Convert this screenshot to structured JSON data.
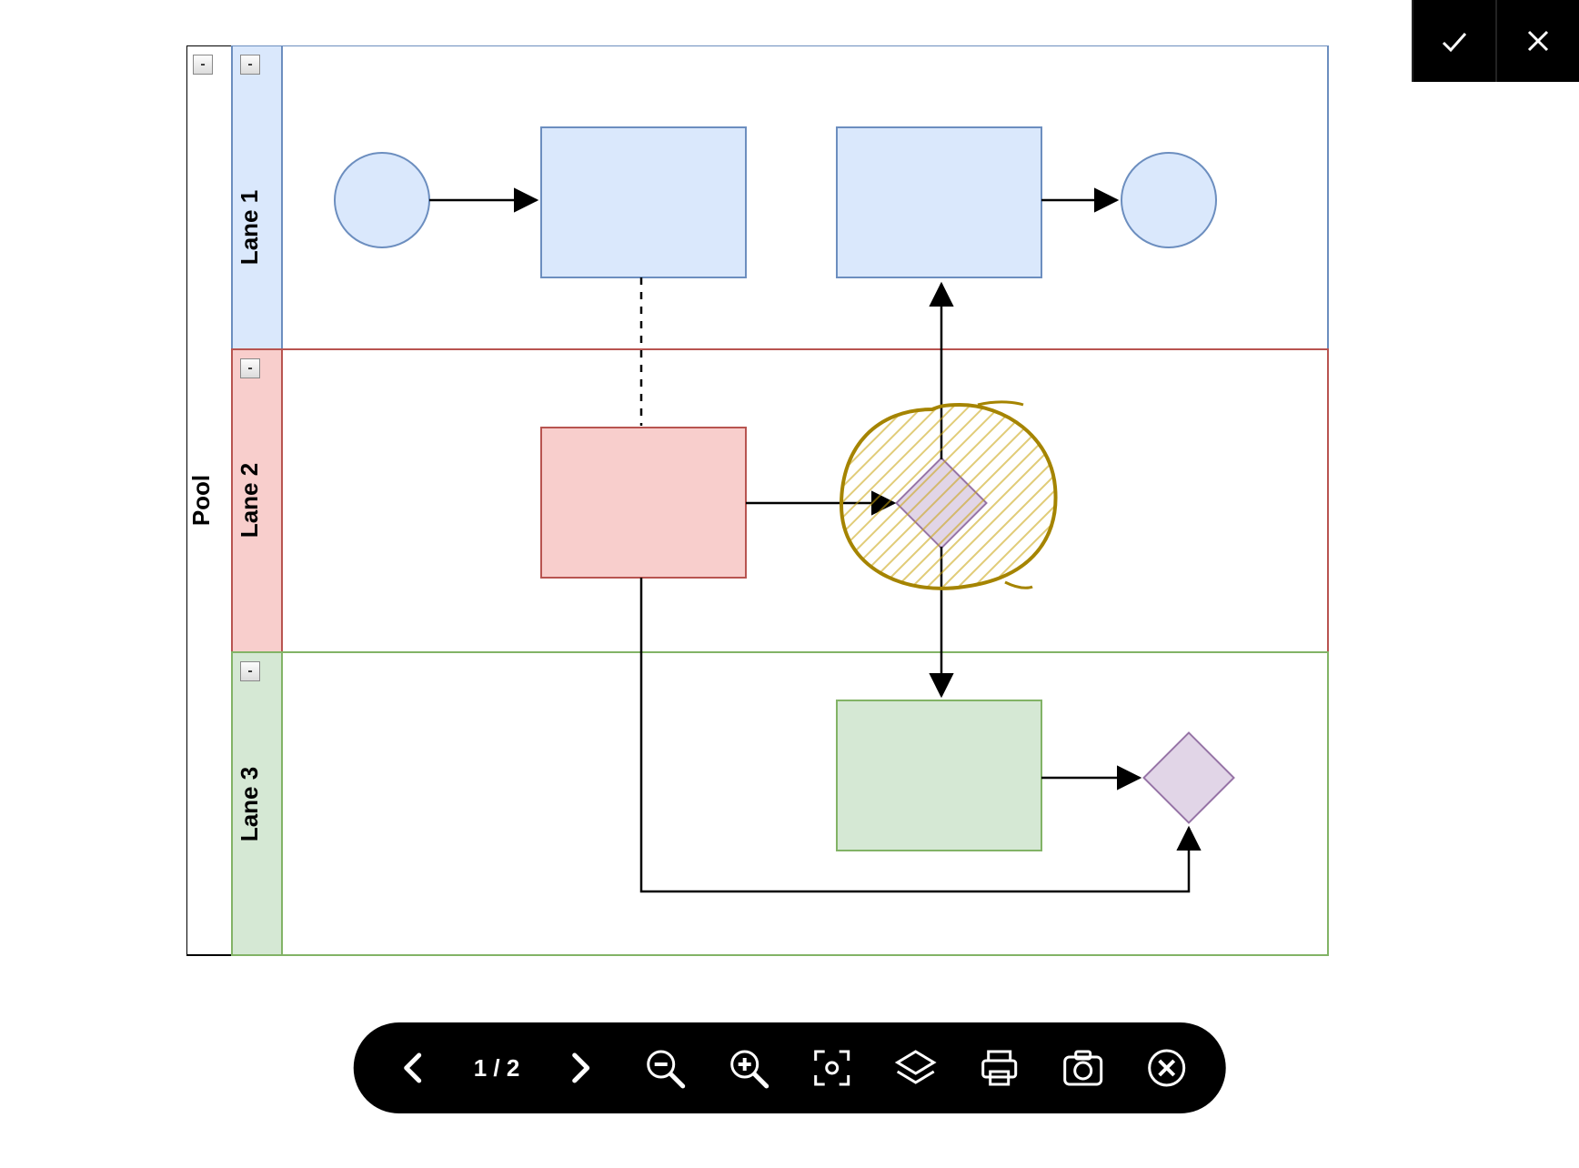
{
  "pool": {
    "title": "Pool",
    "lanes": [
      {
        "label": "Lane 1",
        "fill": "#dae8fc",
        "stroke": "#6c8ebf"
      },
      {
        "label": "Lane 2",
        "fill": "#f8cecc",
        "stroke": "#b85450"
      },
      {
        "label": "Lane 3",
        "fill": "#d5e8d4",
        "stroke": "#82b366"
      }
    ],
    "collapse_glyph": "-"
  },
  "shapes": {
    "lane1_start_circle": {
      "fill": "#dae8fc",
      "stroke": "#6c8ebf"
    },
    "lane1_task1": {
      "fill": "#dae8fc",
      "stroke": "#6c8ebf"
    },
    "lane1_task2": {
      "fill": "#dae8fc",
      "stroke": "#6c8ebf"
    },
    "lane1_end_circle": {
      "fill": "#dae8fc",
      "stroke": "#6c8ebf"
    },
    "lane2_task": {
      "fill": "#f8cecc",
      "stroke": "#b85450"
    },
    "lane2_gateway": {
      "fill": "#e1d5e7",
      "stroke": "#9673a6"
    },
    "lane3_task": {
      "fill": "#d5e8d4",
      "stroke": "#82b366"
    },
    "lane3_gateway": {
      "fill": "#e1d5e7",
      "stroke": "#9673a6"
    }
  },
  "annotation": {
    "type": "freehand-highlight",
    "color": "#c9a20a"
  },
  "toolbar": {
    "page_current": 1,
    "page_total": 2,
    "page_label": "1 / 2"
  },
  "top_actions": {
    "confirm": "confirm",
    "cancel": "cancel"
  }
}
